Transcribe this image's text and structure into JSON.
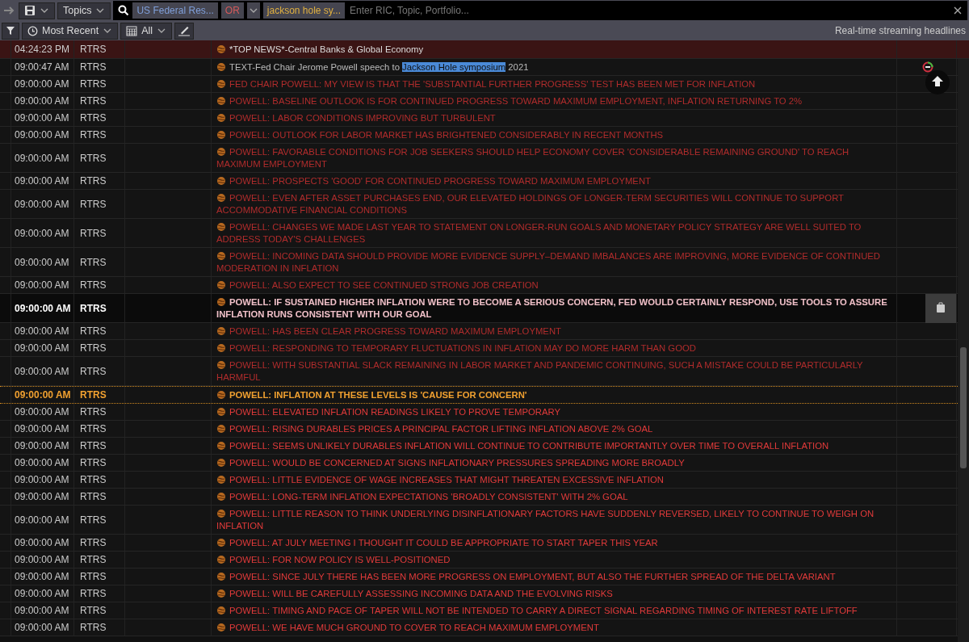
{
  "search_bar": {
    "topics_label": "Topics",
    "terms": [
      {
        "kind": "topic",
        "text": "US Federal Res..."
      },
      {
        "kind": "operator",
        "text": "OR"
      },
      {
        "kind": "keyword",
        "text": "jackson hole sy..."
      }
    ],
    "placeholder": "Enter RIC, Topic, Portfolio..."
  },
  "filter_bar": {
    "sort_label": "Most Recent",
    "range_label": "All",
    "caption": "Real-time streaming headlines"
  },
  "pinned": {
    "time": "04:24:23 PM",
    "source": "RTRS",
    "headline": "*TOP NEWS*-Central Banks & Global Economy"
  },
  "rows": [
    {
      "time": "09:00:47 AM",
      "source": "RTRS",
      "kind": "plain",
      "before": "TEXT-Fed Chair Jerome Powell speech to ",
      "match": "Jackson Hole symposium",
      "after": " 2021"
    },
    {
      "time": "09:00:00 AM",
      "source": "RTRS",
      "kind": "dim",
      "before": "FED CHAIR POWELL: MY VIEW IS THAT THE 'SUBSTANTIAL FURTHER PROGRESS' TEST HAS BEEN MET FOR INFLATION"
    },
    {
      "time": "09:00:00 AM",
      "source": "RTRS",
      "kind": "dim",
      "before": "POWELL: BASELINE OUTLOOK IS FOR CONTINUED PROGRESS TOWARD MAXIMUM EMPLOYMENT, INFLATION RETURNING TO 2%"
    },
    {
      "time": "09:00:00 AM",
      "source": "RTRS",
      "kind": "dim",
      "before": "POWELL: LABOR CONDITIONS IMPROVING BUT TURBULENT"
    },
    {
      "time": "09:00:00 AM",
      "source": "RTRS",
      "kind": "dim",
      "before": "POWELL: OUTLOOK FOR LABOR MARKET HAS BRIGHTENED CONSIDERABLY IN RECENT MONTHS"
    },
    {
      "time": "09:00:00 AM",
      "source": "RTRS",
      "kind": "dim",
      "before": "POWELL: FAVORABLE CONDITIONS FOR JOB SEEKERS SHOULD HELP ECONOMY COVER 'CONSIDERABLE REMAINING GROUND' TO REACH MAXIMUM EMPLOYMENT"
    },
    {
      "time": "09:00:00 AM",
      "source": "RTRS",
      "kind": "dim",
      "before": "POWELL: PROSPECTS 'GOOD' FOR CONTINUED PROGRESS TOWARD MAXIMUM EMPLOYMENT"
    },
    {
      "time": "09:00:00 AM",
      "source": "RTRS",
      "kind": "dim",
      "before": "POWELL: EVEN AFTER ASSET PURCHASES END, OUR ELEVATED HOLDINGS OF LONGER-TERM SECURITIES WILL CONTINUE TO SUPPORT ACCOMMODATIVE FINANCIAL CONDITIONS"
    },
    {
      "time": "09:00:00 AM",
      "source": "RTRS",
      "kind": "dim",
      "before": "POWELL: CHANGES WE MADE LAST YEAR TO STATEMENT ON LONGER-RUN GOALS AND MONETARY POLICY STRATEGY ARE WELL SUITED TO ADDRESS TODAY'S CHALLENGES"
    },
    {
      "time": "09:00:00 AM",
      "source": "RTRS",
      "kind": "dim",
      "before": "POWELL: INCOMING DATA SHOULD PROVIDE MORE EVIDENCE SUPPLY–DEMAND IMBALANCES ARE IMPROVING, MORE EVIDENCE OF CONTINUED MODERATION IN INFLATION"
    },
    {
      "time": "09:00:00 AM",
      "source": "RTRS",
      "kind": "dim",
      "before": "POWELL: ALSO EXPECT TO SEE CONTINUED STRONG JOB CREATION"
    },
    {
      "time": "09:00:00 AM",
      "source": "RTRS",
      "kind": "hover",
      "before": "POWELL: IF SUSTAINED HIGHER INFLATION WERE TO BECOME A SERIOUS CONCERN, FED WOULD CERTAINLY RESPOND, USE TOOLS TO ASSURE INFLATION RUNS CONSISTENT WITH OUR GOAL"
    },
    {
      "time": "09:00:00 AM",
      "source": "RTRS",
      "kind": "dim",
      "before": "POWELL: HAS BEEN CLEAR PROGRESS TOWARD MAXIMUM EMPLOYMENT"
    },
    {
      "time": "09:00:00 AM",
      "source": "RTRS",
      "kind": "dim",
      "before": "POWELL: RESPONDING TO TEMPORARY FLUCTUATIONS IN INFLATION MAY DO MORE HARM THAN GOOD"
    },
    {
      "time": "09:00:00 AM",
      "source": "RTRS",
      "kind": "dim",
      "before": "POWELL: WITH SUBSTANTIAL SLACK REMAINING IN LABOR MARKET AND PANDEMIC CONTINUING, SUCH A MISTAKE COULD BE PARTICULARLY HARMFUL"
    },
    {
      "time": "09:00:00 AM",
      "source": "RTRS",
      "kind": "focus",
      "before": "POWELL: INFLATION AT THESE LEVELS IS 'CAUSE FOR CONCERN'"
    },
    {
      "time": "09:00:00 AM",
      "source": "RTRS",
      "kind": "bright",
      "before": "POWELL: ELEVATED INFLATION READINGS LIKELY TO PROVE TEMPORARY"
    },
    {
      "time": "09:00:00 AM",
      "source": "RTRS",
      "kind": "bright",
      "before": "POWELL: RISING DURABLES PRICES A PRINCIPAL FACTOR LIFTING INFLATION ABOVE 2% GOAL"
    },
    {
      "time": "09:00:00 AM",
      "source": "RTRS",
      "kind": "bright",
      "before": "POWELL: SEEMS UNLIKELY DURABLES INFLATION WILL CONTINUE TO CONTRIBUTE IMPORTANTLY OVER TIME TO OVERALL INFLATION"
    },
    {
      "time": "09:00:00 AM",
      "source": "RTRS",
      "kind": "bright",
      "before": "POWELL: WOULD BE CONCERNED AT SIGNS INFLATIONARY PRESSURES SPREADING MORE BROADLY"
    },
    {
      "time": "09:00:00 AM",
      "source": "RTRS",
      "kind": "bright",
      "before": "POWELL: LITTLE EVIDENCE OF WAGE INCREASES THAT MIGHT THREATEN EXCESSIVE INFLATION"
    },
    {
      "time": "09:00:00 AM",
      "source": "RTRS",
      "kind": "bright",
      "before": "POWELL: LONG-TERM INFLATION EXPECTATIONS 'BROADLY CONSISTENT' WITH 2% GOAL"
    },
    {
      "time": "09:00:00 AM",
      "source": "RTRS",
      "kind": "bright",
      "before": "POWELL: LITTLE REASON TO THINK UNDERLYING DISINFLATIONARY FACTORS HAVE SUDDENLY REVERSED, LIKELY TO CONTINUE TO WEIGH ON INFLATION"
    },
    {
      "time": "09:00:00 AM",
      "source": "RTRS",
      "kind": "bright",
      "before": "POWELL: AT JULY MEETING I THOUGHT IT COULD BE APPROPRIATE TO START TAPER THIS YEAR"
    },
    {
      "time": "09:00:00 AM",
      "source": "RTRS",
      "kind": "bright",
      "before": "POWELL: FOR NOW POLICY IS WELL-POSITIONED"
    },
    {
      "time": "09:00:00 AM",
      "source": "RTRS",
      "kind": "bright",
      "before": "POWELL: SINCE JULY THERE HAS BEEN MORE PROGRESS ON EMPLOYMENT, BUT ALSO THE FURTHER SPREAD OF THE DELTA VARIANT"
    },
    {
      "time": "09:00:00 AM",
      "source": "RTRS",
      "kind": "bright",
      "before": "POWELL: WILL BE CAREFULLY ASSESSING INCOMING DATA AND THE EVOLVING RISKS"
    },
    {
      "time": "09:00:00 AM",
      "source": "RTRS",
      "kind": "bright",
      "before": "POWELL: TIMING AND PACE OF TAPER WILL NOT BE INTENDED TO CARRY A DIRECT SIGNAL REGARDING TIMING OF INTEREST RATE LIFTOFF"
    },
    {
      "time": "09:00:00 AM",
      "source": "RTRS",
      "kind": "bright",
      "before": "POWELL: WE HAVE MUCH GROUND TO COVER TO REACH MAXIMUM EMPLOYMENT"
    }
  ]
}
